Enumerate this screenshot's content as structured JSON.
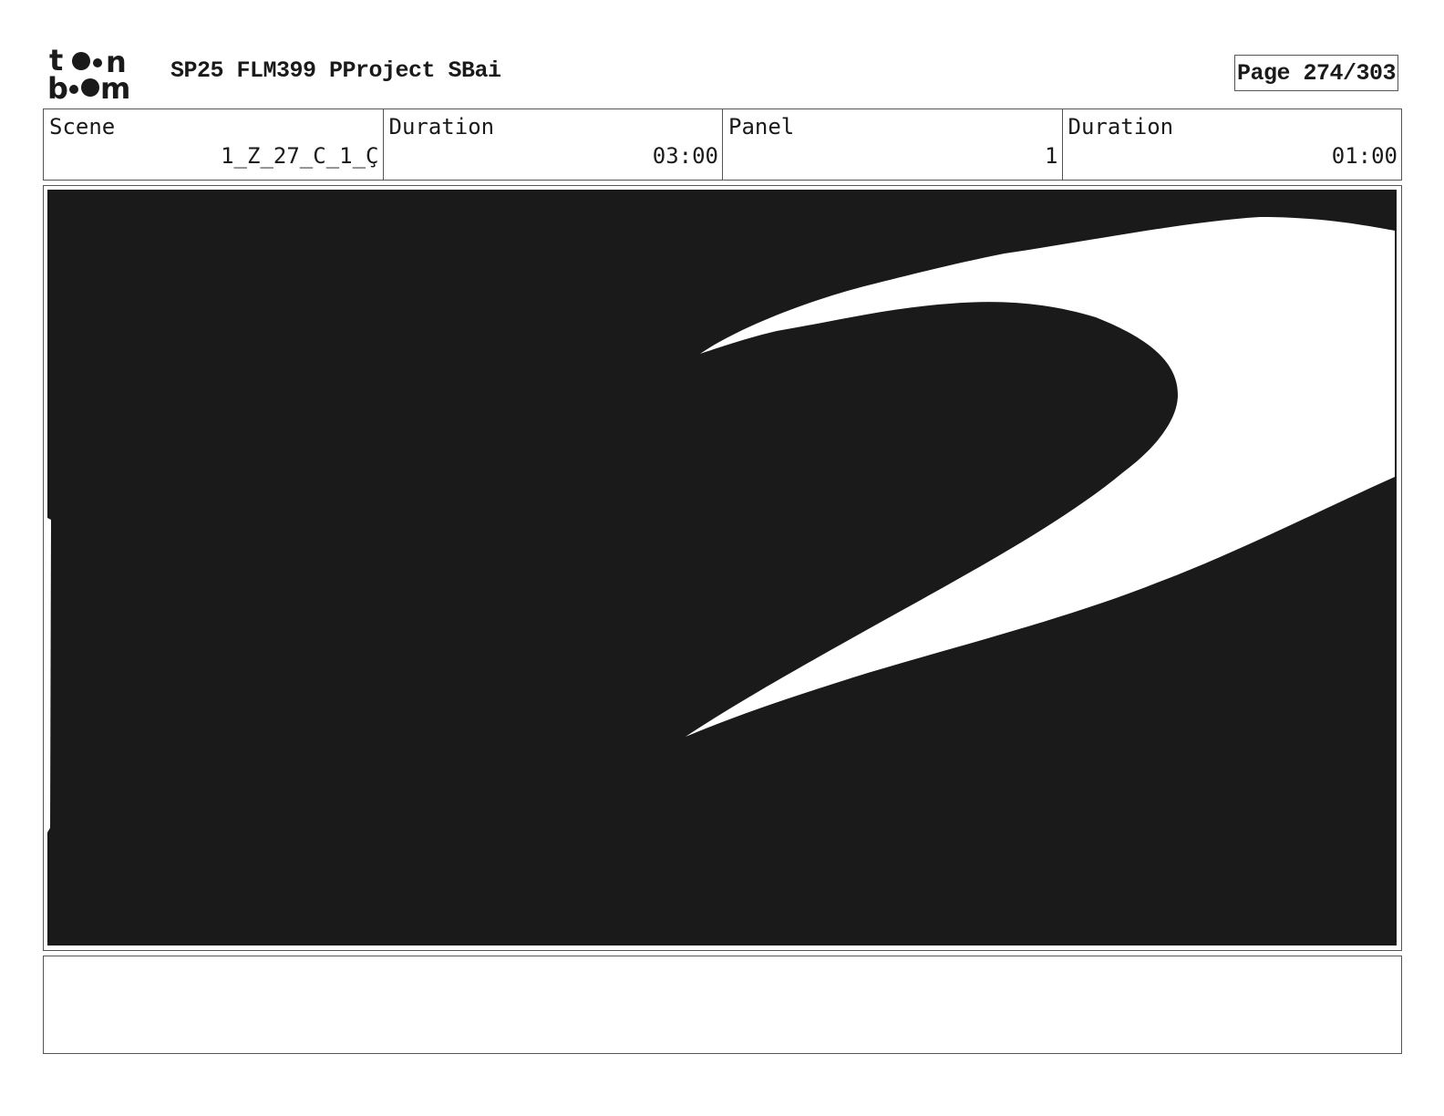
{
  "header": {
    "logo_text": "toon boom",
    "title": "SP25 FLM399 PProject SBai",
    "page": "Page 274/303"
  },
  "info": {
    "scene_label": "Scene",
    "scene_value": "1_Z_27_C_1_Ç",
    "scene_duration_label": "Duration",
    "scene_duration_value": "03:00",
    "panel_label": "Panel",
    "panel_value": "1",
    "panel_duration_label": "Duration",
    "panel_duration_value": "01:00"
  },
  "panel": {
    "ink_color": "#1a1a1a",
    "paper_color": "#ffffff"
  },
  "notes": {
    "text": ""
  }
}
